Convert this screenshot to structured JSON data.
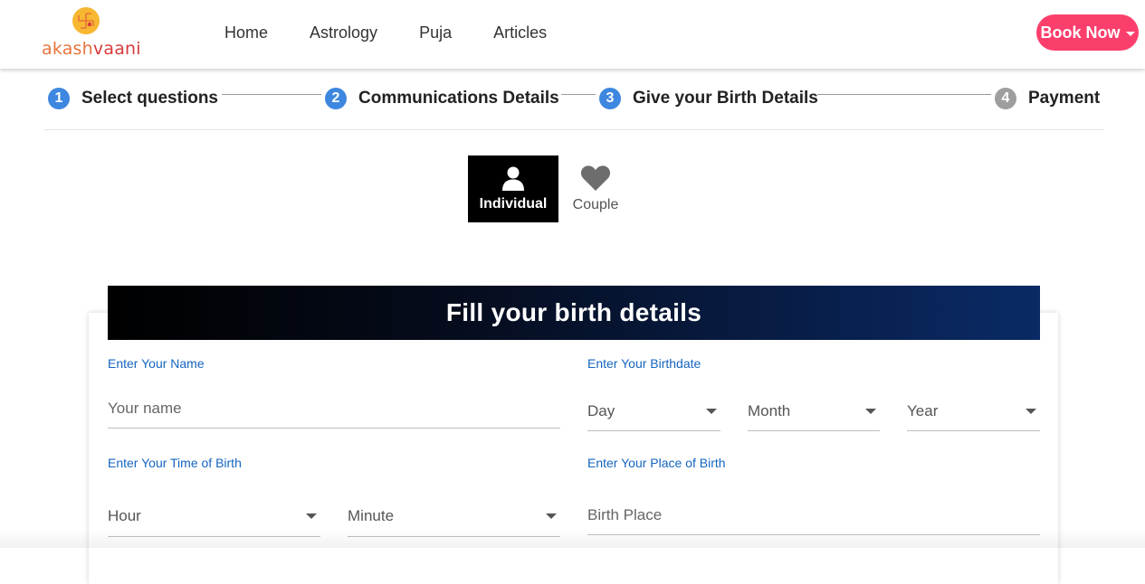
{
  "brand": {
    "name_part1": "akash",
    "name_part2": "vaani",
    "logo_icon": "swastik-logo-icon"
  },
  "nav": {
    "items": [
      "Home",
      "Astrology",
      "Puja",
      "Articles"
    ]
  },
  "header": {
    "book_now_label": "Book Now",
    "accent_color": "#fb3f6c"
  },
  "stepper": {
    "steps": [
      {
        "number": "1",
        "label": "Select questions"
      },
      {
        "number": "2",
        "label": "Communications Details"
      },
      {
        "number": "3",
        "label": "Give your Birth Details"
      },
      {
        "number": "4",
        "label": "Payment"
      }
    ],
    "active_color": "#3d87e0",
    "inactive_color": "#9e9e9e"
  },
  "toggle": {
    "individual_label": "Individual",
    "couple_label": "Couple",
    "selected": "Individual"
  },
  "form": {
    "title": "Fill your birth details",
    "name_label": "Enter Your Name",
    "name_placeholder": "Your name",
    "birthdate_label": "Enter Your Birthdate",
    "day": "Day",
    "month": "Month",
    "year": "Year",
    "time_label": "Enter Your Time of Birth",
    "hour": "Hour",
    "minute": "Minute",
    "place_label": "Enter Your Place of Birth",
    "place_placeholder": "Birth Place",
    "label_color": "#1565c0"
  }
}
